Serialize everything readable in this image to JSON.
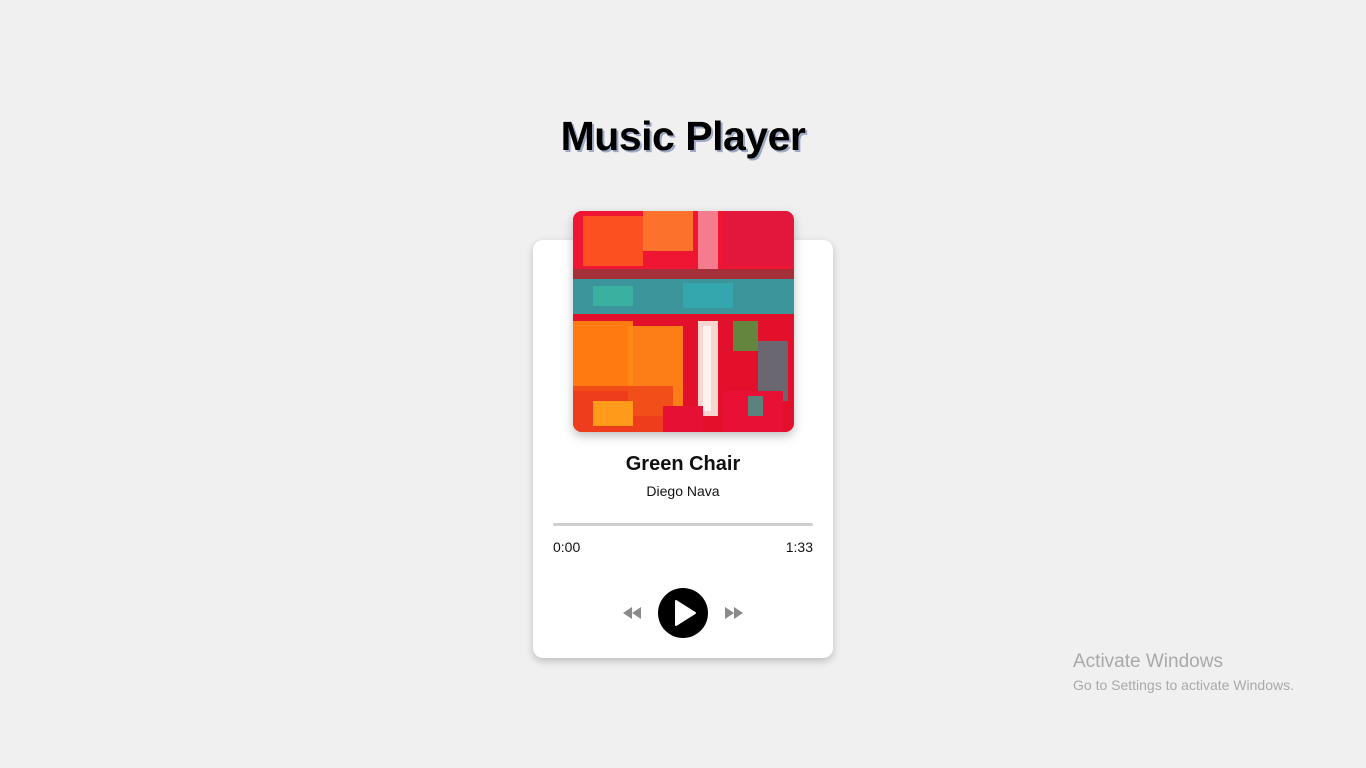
{
  "page": {
    "title": "Music Player"
  },
  "player": {
    "track_title": "Green Chair",
    "artist": "Diego Nava",
    "current_time": "0:00",
    "duration": "1:33",
    "progress": 0,
    "cover_icon": "abstract-painting-album-art",
    "controls": {
      "prev_icon": "rewind-icon",
      "play_icon": "play-icon",
      "next_icon": "fast-forward-icon"
    }
  },
  "watermark": {
    "title": "Activate Windows",
    "subtitle": "Go to Settings to activate Windows."
  },
  "colors": {
    "background": "#f0f0f0",
    "card": "#ffffff",
    "accent": "#000000",
    "control_gray": "#8a8a8a",
    "progress_track": "#cfcfcf"
  }
}
